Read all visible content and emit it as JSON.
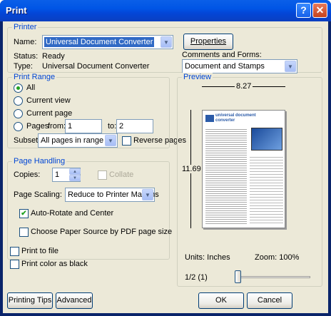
{
  "window": {
    "title": "Print",
    "help_icon": "?",
    "close_icon": "✕"
  },
  "printer": {
    "legend": "Printer",
    "name_label": "Name:",
    "name_value": "Universal Document Converter",
    "properties_label": "Properties",
    "status_label": "Status:",
    "status_value": "Ready",
    "type_label": "Type:",
    "type_value": "Universal Document Converter",
    "comments_label": "Comments and Forms:",
    "comments_value": "Document and Stamps"
  },
  "print_range": {
    "legend": "Print Range",
    "all": "All",
    "current_view": "Current view",
    "current_page": "Current page",
    "pages": "Pages",
    "from_label": "from:",
    "from_value": "1",
    "to_label": "to:",
    "to_value": "2",
    "subset_label": "Subset:",
    "subset_value": "All pages in range",
    "reverse_label": "Reverse pages"
  },
  "page_handling": {
    "legend": "Page Handling",
    "copies_label": "Copies:",
    "copies_value": "1",
    "collate_label": "Collate",
    "scaling_label": "Page Scaling:",
    "scaling_value": "Reduce to Printer Margins",
    "auto_rotate_label": "Auto-Rotate and Center",
    "auto_rotate_checked": true,
    "choose_paper_label": "Choose Paper Source by PDF page size"
  },
  "options": {
    "print_to_file": "Print to file",
    "print_color_black": "Print color as black"
  },
  "preview": {
    "legend": "Preview",
    "width_dim": "8.27",
    "height_dim": "11.69",
    "units": "Units: Inches",
    "zoom": "Zoom: 100%",
    "page_indicator": "1/2 (1)",
    "doc_title_1": "universal document",
    "doc_title_2": "converter",
    "page_fraction": 0.0
  },
  "footer": {
    "tips": "Printing Tips",
    "advanced": "Advanced",
    "ok": "OK",
    "cancel": "Cancel"
  }
}
